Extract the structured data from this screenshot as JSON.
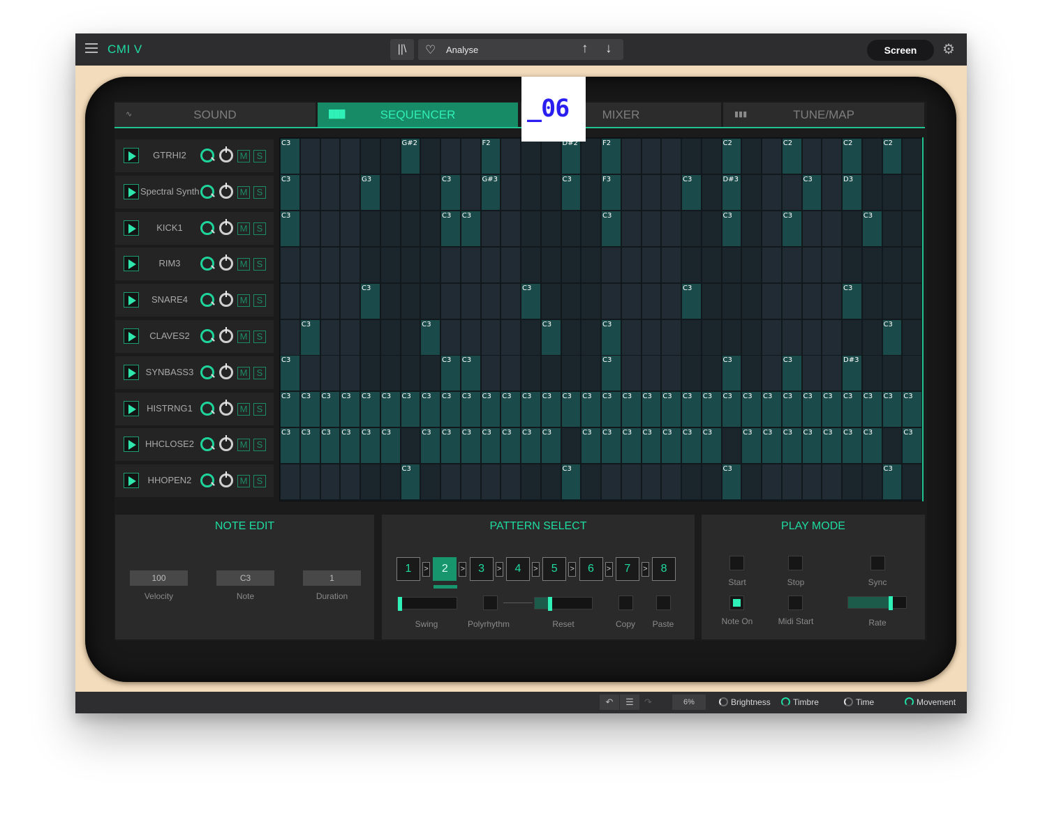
{
  "topbar": {
    "app_name": "CMI V",
    "preset_name": "Analyse",
    "screen_label": "Screen",
    "icons": [
      "menu-icon",
      "library-icon",
      "heart-icon",
      "arrow-up-icon",
      "arrow-down-icon",
      "gear-icon"
    ]
  },
  "tabs": [
    {
      "label": "SOUND",
      "icon": "waveform-icon",
      "active": false
    },
    {
      "label": "SEQUENCER",
      "icon": "bars-icon",
      "active": true
    },
    {
      "label": "MIXER",
      "icon": "",
      "active": false
    },
    {
      "label": "TUNE/MAP",
      "icon": "keyboard-icon",
      "active": false
    }
  ],
  "tracks": [
    {
      "name": "GTRHI2",
      "mute": "M",
      "solo": "S"
    },
    {
      "name": "Spectral Synth",
      "mute": "M",
      "solo": "S"
    },
    {
      "name": "KICK1",
      "mute": "M",
      "solo": "S"
    },
    {
      "name": "RIM3",
      "mute": "M",
      "solo": "S"
    },
    {
      "name": "SNARE4",
      "mute": "M",
      "solo": "S"
    },
    {
      "name": "CLAVES2",
      "mute": "M",
      "solo": "S"
    },
    {
      "name": "SYNBASS3",
      "mute": "M",
      "solo": "S"
    },
    {
      "name": "HISTRNG1",
      "mute": "M",
      "solo": "S"
    },
    {
      "name": "HHCLOSE2",
      "mute": "M",
      "solo": "S"
    },
    {
      "name": "HHOPEN2",
      "mute": "M",
      "solo": "S"
    }
  ],
  "sequencer_grid": {
    "steps": 32,
    "rows": [
      {
        "0": "C3",
        "6": "G#2",
        "10": "F2",
        "14": "D#2",
        "16": "F2",
        "22": "C2",
        "25": "C2",
        "28": "C2",
        "30": "C2"
      },
      {
        "0": "C3",
        "4": "G3",
        "8": "C3",
        "10": "G#3",
        "14": "C3",
        "16": "F3",
        "20": "C3",
        "22": "D#3",
        "26": "C3",
        "28": "D3"
      },
      {
        "0": "C3",
        "8": "C3",
        "9": "C3",
        "16": "C3",
        "22": "C3",
        "25": "C3",
        "29": "C3"
      },
      {},
      {
        "4": "C3",
        "12": "C3",
        "20": "C3",
        "28": "C3"
      },
      {
        "1": "C3",
        "7": "C3",
        "13": "C3",
        "16": "C3",
        "30": "C3"
      },
      {
        "0": "C3",
        "8": "C3",
        "9": "C3",
        "16": "C3",
        "22": "C3",
        "25": "C3",
        "28": "D#3"
      },
      {
        "0": "C3",
        "1": "C3",
        "2": "C3",
        "3": "C3",
        "4": "C3",
        "5": "C3",
        "6": "C3",
        "7": "C3",
        "8": "C3",
        "9": "C3",
        "10": "C3",
        "11": "C3",
        "12": "C3",
        "13": "C3",
        "14": "C3",
        "15": "C3",
        "16": "C3",
        "17": "C3",
        "18": "C3",
        "19": "C3",
        "20": "C3",
        "21": "C3",
        "22": "C3",
        "23": "C3",
        "24": "C3",
        "25": "C3",
        "26": "C3",
        "27": "C3",
        "28": "C3",
        "29": "C3",
        "30": "C3",
        "31": "C3"
      },
      {
        "0": "C3",
        "1": "C3",
        "2": "C3",
        "3": "C3",
        "4": "C3",
        "5": "C3",
        "7": "C3",
        "8": "C3",
        "9": "C3",
        "10": "C3",
        "11": "C3",
        "12": "C3",
        "13": "C3",
        "15": "C3",
        "16": "C3",
        "17": "C3",
        "18": "C3",
        "19": "C3",
        "20": "C3",
        "21": "C3",
        "23": "C3",
        "24": "C3",
        "25": "C3",
        "26": "C3",
        "27": "C3",
        "28": "C3",
        "29": "C3",
        "31": "C3"
      },
      {
        "6": "C3",
        "14": "C3",
        "22": "C3",
        "30": "C3"
      }
    ]
  },
  "note_edit": {
    "title": "NOTE EDIT",
    "velocity_value": "100",
    "velocity_label": "Velocity",
    "note_value": "C3",
    "note_label": "Note",
    "duration_value": "1",
    "duration_label": "Duration"
  },
  "pattern_select": {
    "title": "PATTERN SELECT",
    "patterns": [
      "1",
      "2",
      "3",
      "4",
      "5",
      "6",
      "7",
      "8"
    ],
    "arrow": ">",
    "selected": "2",
    "swing_label": "Swing",
    "swing_level": 0,
    "polyrhythm_label": "Polyrhythm",
    "reset_label": "Reset",
    "reset_level": 0.25,
    "copy_label": "Copy",
    "paste_label": "Paste"
  },
  "play_mode": {
    "title": "PLAY MODE",
    "start_label": "Start",
    "stop_label": "Stop",
    "sync_label": "Sync",
    "note_on_label": "Note On",
    "note_on_checked": true,
    "midi_start_label": "Midi Start",
    "rate_label": "Rate",
    "rate_level": 0.75
  },
  "bottombar": {
    "undo_icon": "undo-icon",
    "history_icon": "list-icon",
    "redo_icon": "redo-icon",
    "cpu": "6%",
    "macros": [
      "Brightness",
      "Timbre",
      "Time",
      "Movement"
    ]
  },
  "overlay": {
    "text": "_06"
  },
  "colors": {
    "accent": "#1fdca0",
    "active_tab": "#178a66",
    "note_cell": "#1b4a4a",
    "empty_cell": "#212b33",
    "frame": "#f2dcbc",
    "overlay_text": "#2a1ff0"
  }
}
